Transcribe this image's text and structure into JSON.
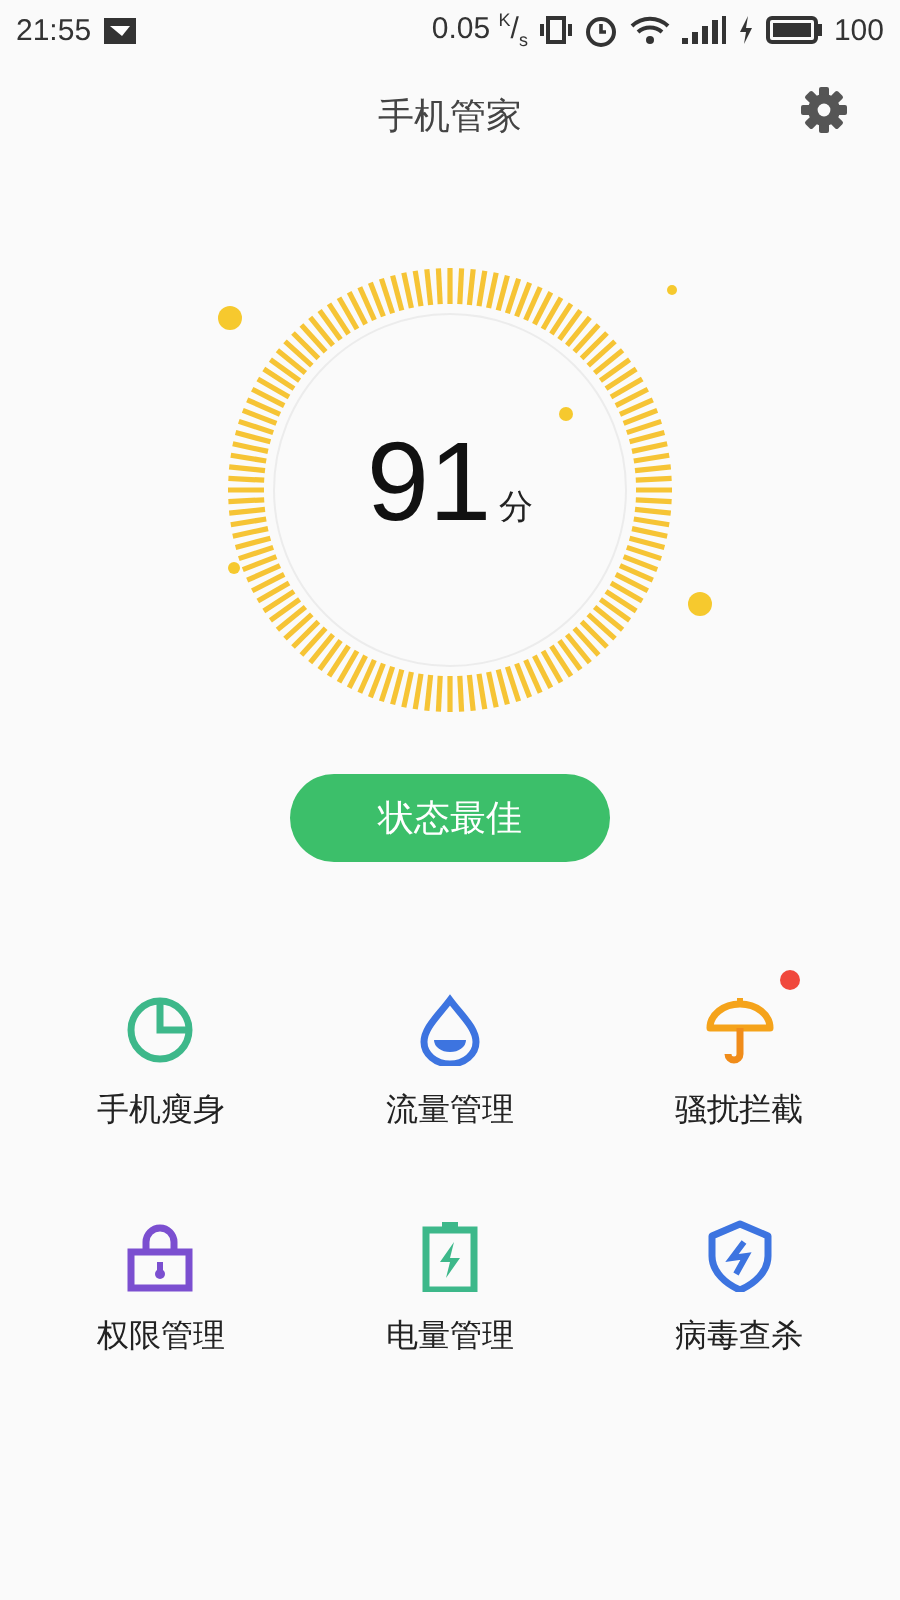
{
  "status_bar": {
    "time": "21:55",
    "net_speed": "0.05 $^{K}$/$_{s}$",
    "battery": "100"
  },
  "header": {
    "title": "手机管家"
  },
  "score": {
    "value": "91",
    "unit": "分"
  },
  "status_button": {
    "label": "状态最佳"
  },
  "tools": [
    {
      "kind": "pie",
      "label": "手机瘦身",
      "color": "#3db88a",
      "badge": false
    },
    {
      "kind": "drop",
      "label": "流量管理",
      "color": "#3d74e0",
      "badge": false
    },
    {
      "kind": "umbrella",
      "label": "骚扰拦截",
      "color": "#f5a31a",
      "badge": true
    },
    {
      "kind": "lock",
      "label": "权限管理",
      "color": "#7b4fd0",
      "badge": false
    },
    {
      "kind": "battery",
      "label": "电量管理",
      "color": "#3db88a",
      "badge": false
    },
    {
      "kind": "shield",
      "label": "病毒查杀",
      "color": "#3d74e0",
      "badge": false
    }
  ]
}
